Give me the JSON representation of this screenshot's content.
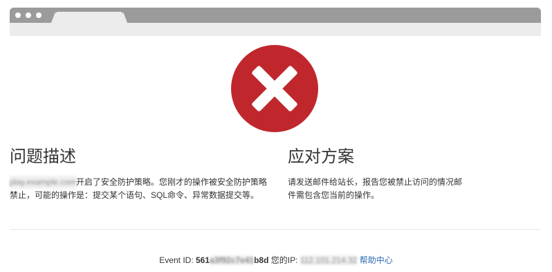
{
  "left": {
    "title": "问题描述",
    "domain_masked": "play.example.com",
    "description": "开启了安全防护策略。您刚才的操作被安全防护策略禁止，可能的操作是：提交某个语句、SQL命令、异常数据提交等。"
  },
  "right": {
    "title": "应对方案",
    "description": "请发送邮件给站长，报告您被禁止访问的情况邮件需包含您当前的操作。"
  },
  "footer": {
    "event_label": "Event ID:",
    "event_id_prefix": "561",
    "event_id_masked": "a3f92c7e41",
    "event_id_suffix": "b8d",
    "ip_label": "您的IP:",
    "ip_masked": "112.101.214.32",
    "help_link": "帮助中心"
  },
  "icons": {
    "badge": "error-x-icon"
  },
  "colors": {
    "error_red": "#c0272d",
    "link_blue": "#2e6cb5"
  }
}
